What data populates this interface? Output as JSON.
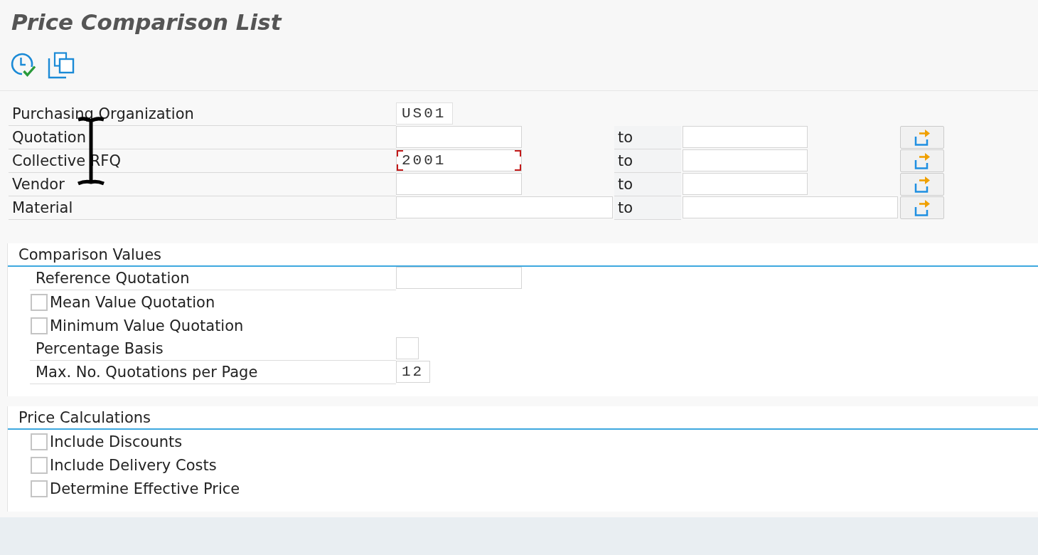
{
  "title": "Price Comparison List",
  "selection": {
    "rows": [
      {
        "kind": "single",
        "label": "Purchasing Organization",
        "value": "US01",
        "focused": false
      },
      {
        "kind": "range",
        "label": "Quotation",
        "to_label": "to",
        "focused": false
      },
      {
        "kind": "range",
        "label": "Collective RFQ",
        "value": "2001",
        "to_label": "to",
        "focused": true
      },
      {
        "kind": "range",
        "label": "Vendor",
        "to_label": "to",
        "focused": false
      },
      {
        "kind": "wide_range",
        "label": "Material",
        "to_label": "to",
        "focused": false
      }
    ]
  },
  "sections": [
    {
      "title": "Comparison Values",
      "items": [
        {
          "kind": "text_field",
          "label": "Reference Quotation"
        },
        {
          "kind": "checkbox",
          "label": "Mean Value Quotation",
          "checked": false
        },
        {
          "kind": "checkbox",
          "label": "Minimum Value Quotation",
          "checked": false
        },
        {
          "kind": "flag_field",
          "label": "Percentage Basis"
        },
        {
          "kind": "number_field",
          "label": "Max. No. Quotations per Page",
          "value": "12"
        }
      ]
    },
    {
      "title": "Price Calculations",
      "items": [
        {
          "kind": "checkbox",
          "label": "Include Discounts",
          "checked": false
        },
        {
          "kind": "checkbox",
          "label": "Include Delivery Costs",
          "checked": false
        },
        {
          "kind": "checkbox",
          "label": "Determine Effective Price",
          "checked": false
        }
      ]
    }
  ]
}
